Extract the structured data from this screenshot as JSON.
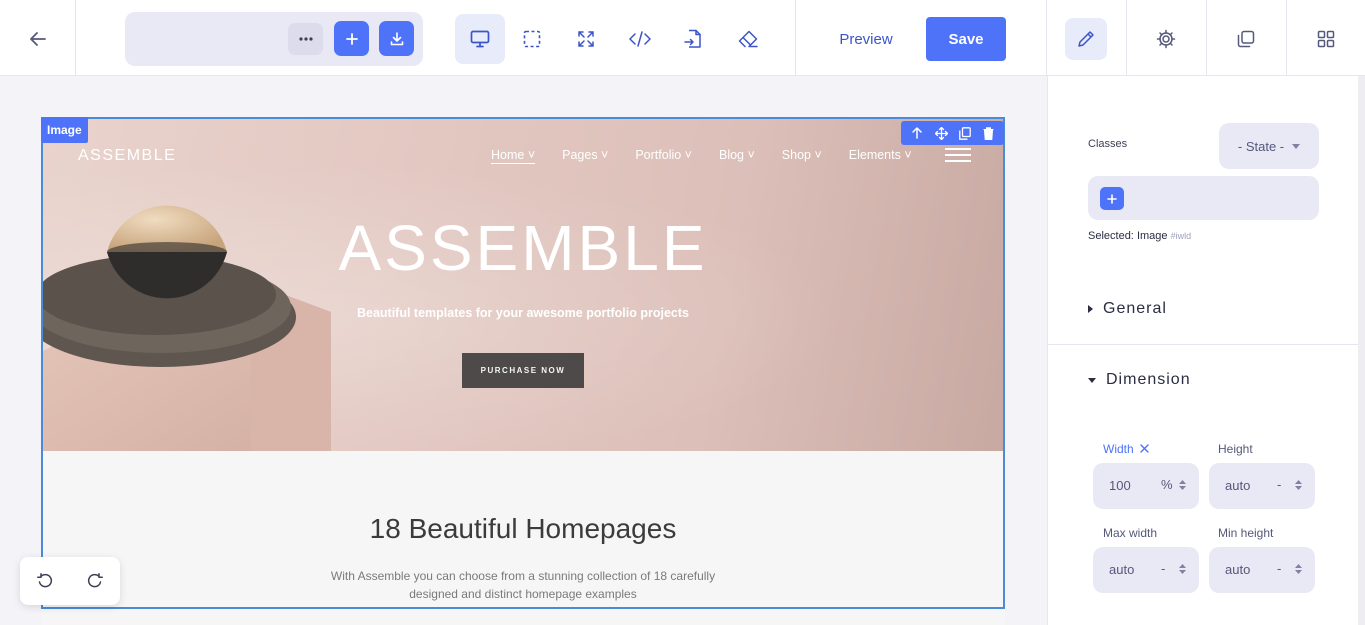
{
  "toolbar": {
    "back_icon": "arrow-left-icon",
    "page_select_value": "",
    "more_icon": "more-horizontal-icon",
    "add_icon": "plus-icon",
    "import_icon": "download-icon",
    "tools": [
      "desktop-icon",
      "select-box-icon",
      "fullscreen-icon",
      "code-icon",
      "export-file-icon",
      "eraser-icon"
    ],
    "preview_label": "Preview",
    "save_label": "Save",
    "right_tabs": [
      "pencil-icon",
      "gear-icon",
      "layers-icon",
      "blocks-icon"
    ],
    "accent": "#4e73f8"
  },
  "canvas": {
    "selected_badge": "Image",
    "hero": {
      "brand": "ASSEMBLE",
      "nav": [
        "Home",
        "Pages",
        "Portfolio",
        "Blog",
        "Shop",
        "Elements"
      ],
      "title": "ASSEMBLE",
      "subtitle": "Beautiful templates for your awesome portfolio projects",
      "cta": "PURCHASE NOW"
    },
    "section": {
      "heading": "18 Beautiful Homepages",
      "paragraph": "With Assemble you can choose from a stunning collection of 18 carefully designed and distinct homepage examples"
    }
  },
  "panel": {
    "classes_label": "Classes",
    "state_label": "- State -",
    "selected_label": "Selected:",
    "selected_name": "Image",
    "selected_id": "#iwld",
    "general_label": "General",
    "dimension_label": "Dimension",
    "width_label": "Width",
    "width_value": "100",
    "width_unit": "%",
    "height_label": "Height",
    "height_value": "auto",
    "height_unit": "-",
    "maxwidth_label": "Max width",
    "maxwidth_value": "auto",
    "maxwidth_unit": "-",
    "minheight_label": "Min height",
    "minheight_value": "auto",
    "minheight_unit": "-"
  }
}
